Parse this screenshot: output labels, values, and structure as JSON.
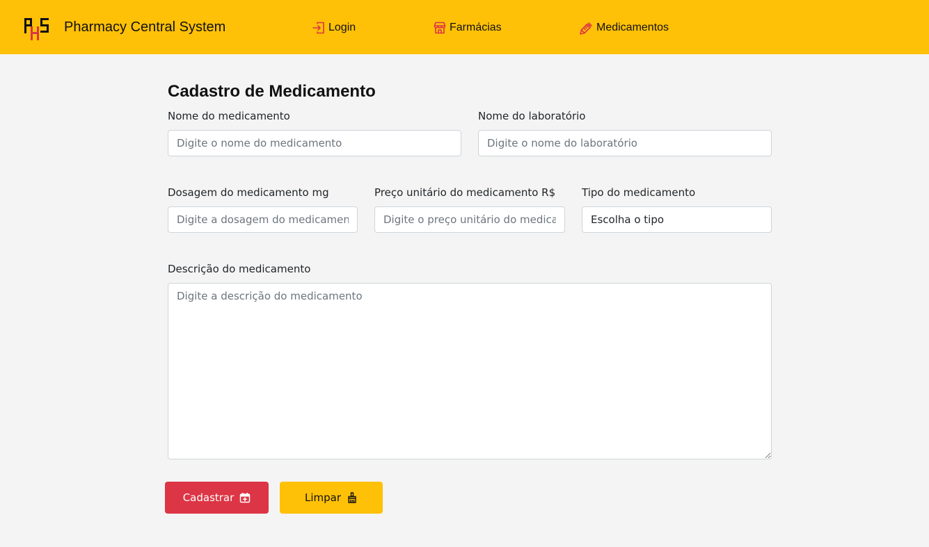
{
  "navbar": {
    "logo_text": "PHS",
    "brand": "Pharmacy Central System",
    "items": [
      {
        "label": "Login",
        "icon": "login-icon"
      },
      {
        "label": "Farmácias",
        "icon": "store-icon"
      },
      {
        "label": "Medicamentos",
        "icon": "syringe-icon"
      }
    ]
  },
  "form": {
    "title": "Cadastro de Medicamento",
    "nome": {
      "label": "Nome do medicamento",
      "placeholder": "Digite o nome do medicamento",
      "value": ""
    },
    "laboratorio": {
      "label": "Nome do laboratório",
      "placeholder": "Digite o nome do laboratório",
      "value": ""
    },
    "dosagem": {
      "label": "Dosagem do medicamento mg",
      "placeholder": "Digite a dosagem do medicamento",
      "value": ""
    },
    "preco": {
      "label": "Preço unitário do medicamento R$",
      "placeholder": "Digite o preço unitário do medicamento",
      "value": ""
    },
    "tipo": {
      "label": "Tipo do medicamento",
      "selected": "Escolha o tipo"
    },
    "descricao": {
      "label": "Descrição do medicamento",
      "placeholder": "Digite a descrição do medicamento",
      "value": ""
    }
  },
  "buttons": {
    "submit": {
      "label": "Cadastrar",
      "icon": "calendar-plus-icon"
    },
    "clear": {
      "label": "Limpar",
      "icon": "broom-icon"
    }
  },
  "colors": {
    "navbar": "#ffc107",
    "icon_accent": "#dc3545",
    "submit": "#dc3545",
    "clear": "#ffc107"
  }
}
